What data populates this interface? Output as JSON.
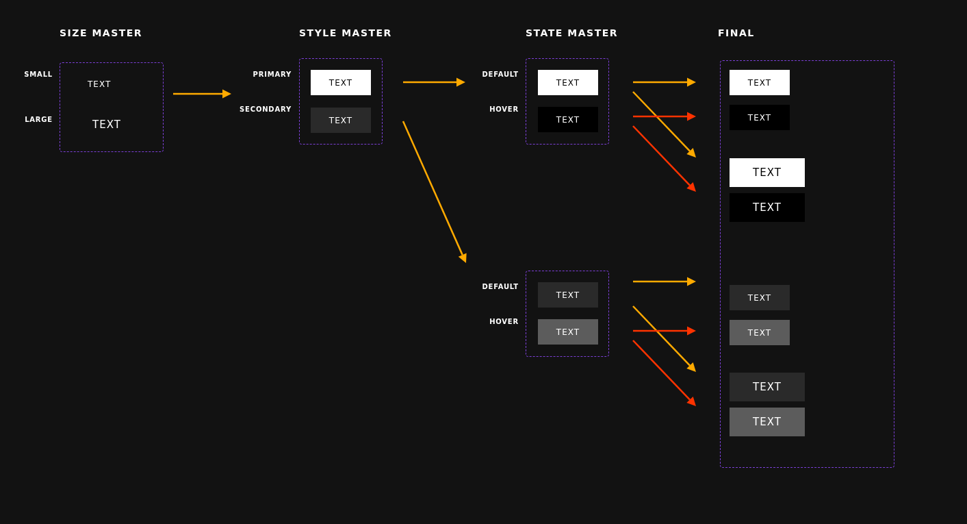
{
  "headings": [
    {
      "title": "SIZE MASTER"
    },
    {
      "title": "STYLE MASTER"
    },
    {
      "title": "STATE MASTER"
    },
    {
      "title": "FINAL"
    }
  ],
  "size_master": {
    "rows": [
      {
        "label": "SMALL",
        "sample": "TEXT",
        "large": false
      },
      {
        "label": "LARGE",
        "sample": "TEXT",
        "large": true
      }
    ]
  },
  "style_master": {
    "rows": [
      {
        "label": "PRIMARY",
        "button": "TEXT",
        "kind": "primary"
      },
      {
        "label": "SECONDARY",
        "button": "TEXT",
        "kind": "secondary"
      }
    ]
  },
  "state_masters": [
    {
      "rows": [
        {
          "label": "DEFAULT",
          "button": "TEXT",
          "kind": "primary"
        },
        {
          "label": "HOVER",
          "button": "TEXT",
          "kind": "inverse"
        }
      ]
    },
    {
      "rows": [
        {
          "label": "DEFAULT",
          "button": "TEXT",
          "kind": "secondary"
        },
        {
          "label": "HOVER",
          "button": "TEXT",
          "kind": "muted"
        }
      ]
    }
  ],
  "final": {
    "buttons": [
      {
        "text": "TEXT",
        "large": false,
        "kind": "primary"
      },
      {
        "text": "TEXT",
        "large": false,
        "kind": "inverse"
      },
      {
        "text": "TEXT",
        "large": true,
        "kind": "primary"
      },
      {
        "text": "TEXT",
        "large": true,
        "kind": "inverse"
      },
      {
        "text": "TEXT",
        "large": false,
        "kind": "secondary"
      },
      {
        "text": "TEXT",
        "large": false,
        "kind": "muted"
      },
      {
        "text": "TEXT",
        "large": true,
        "kind": "secondary"
      },
      {
        "text": "TEXT",
        "large": true,
        "kind": "muted"
      }
    ]
  },
  "arrows": [
    {
      "color": "#ffaa00"
    },
    {
      "color": "#ffaa00"
    },
    {
      "color": "#ffaa00"
    },
    {
      "color": "#ffaa00"
    },
    {
      "color": "#ffaa00"
    },
    {
      "color": "#ff3300"
    },
    {
      "color": "#ff3300"
    },
    {
      "color": "#ffaa00"
    },
    {
      "color": "#ffaa00"
    },
    {
      "color": "#ff3300"
    },
    {
      "color": "#ff3300"
    }
  ]
}
